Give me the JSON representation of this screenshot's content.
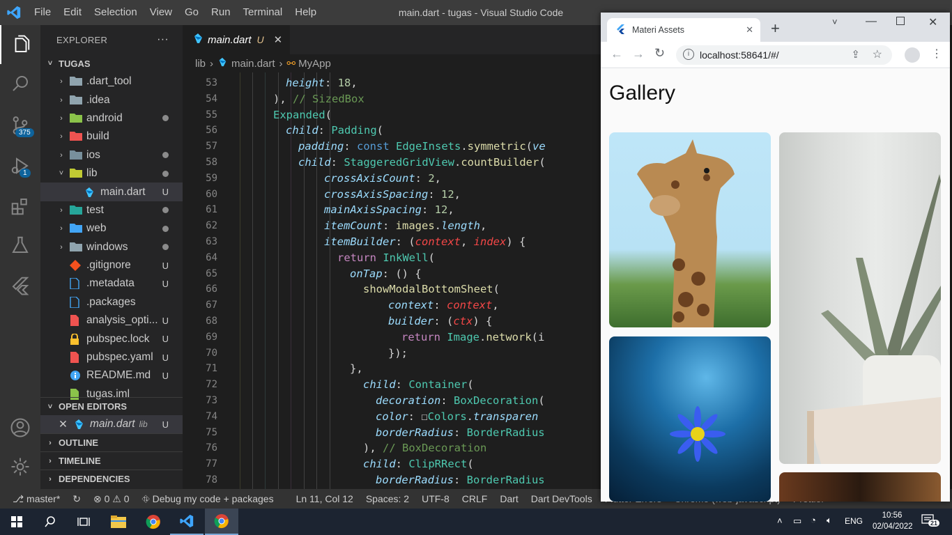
{
  "window": {
    "title": "main.dart - tugas - Visual Studio Code",
    "menu": [
      "File",
      "Edit",
      "Selection",
      "View",
      "Go",
      "Run",
      "Terminal",
      "Help"
    ]
  },
  "activity_bar": {
    "source_control_badge": "375",
    "debug_badge": "1"
  },
  "explorer": {
    "header": "EXPLORER",
    "more": "···",
    "project": "TUGAS",
    "items": [
      {
        "label": ".dart_tool",
        "chev": "›",
        "status": ""
      },
      {
        "label": ".idea",
        "chev": "›",
        "status": ""
      },
      {
        "label": "android",
        "chev": "›",
        "status": "dot"
      },
      {
        "label": "build",
        "chev": "›",
        "status": ""
      },
      {
        "label": "ios",
        "chev": "›",
        "status": "dot"
      },
      {
        "label": "lib",
        "chev": "˅",
        "status": "dot"
      },
      {
        "label": "main.dart",
        "chev": "",
        "status": "U"
      },
      {
        "label": "test",
        "chev": "›",
        "status": "dot"
      },
      {
        "label": "web",
        "chev": "›",
        "status": "dot"
      },
      {
        "label": "windows",
        "chev": "›",
        "status": "dot"
      },
      {
        "label": ".gitignore",
        "chev": "",
        "status": "U"
      },
      {
        "label": ".metadata",
        "chev": "",
        "status": "U"
      },
      {
        "label": ".packages",
        "chev": "",
        "status": ""
      },
      {
        "label": "analysis_opti...",
        "chev": "",
        "status": "U"
      },
      {
        "label": "pubspec.lock",
        "chev": "",
        "status": "U"
      },
      {
        "label": "pubspec.yaml",
        "chev": "",
        "status": "U"
      },
      {
        "label": "README.md",
        "chev": "",
        "status": "U"
      },
      {
        "label": "tugas.iml",
        "chev": "",
        "status": ""
      }
    ],
    "open_editors": "OPEN EDITORS",
    "open_editor_item": {
      "name": "main.dart",
      "dir": "lib",
      "status": "U"
    },
    "outline": "OUTLINE",
    "timeline": "TIMELINE",
    "dependencies": "DEPENDENCIES"
  },
  "editor": {
    "tab": {
      "name": "main.dart",
      "status": "U"
    },
    "breadcrumb": [
      "lib",
      "main.dart",
      "MyApp"
    ],
    "lines": [
      {
        "n": "53",
        "segs": [
          [
            "p",
            "height"
          ],
          [
            "w",
            ": "
          ],
          [
            "n",
            "18"
          ],
          [
            "w",
            ","
          ]
        ]
      },
      {
        "n": "54",
        "segs": [
          [
            "w",
            "), "
          ],
          [
            "c",
            "// SizedBox"
          ]
        ]
      },
      {
        "n": "55",
        "segs": [
          [
            "t",
            "Expanded"
          ],
          [
            "w",
            "("
          ]
        ]
      },
      {
        "n": "56",
        "segs": [
          [
            "p",
            "child"
          ],
          [
            "w",
            ": "
          ],
          [
            "t",
            "Padding"
          ],
          [
            "w",
            "("
          ]
        ]
      },
      {
        "n": "57",
        "segs": [
          [
            "p",
            "padding"
          ],
          [
            "w",
            ": "
          ],
          [
            "kb",
            "const "
          ],
          [
            "t",
            "EdgeInsets"
          ],
          [
            "w",
            "."
          ],
          [
            "f",
            "symmetric"
          ],
          [
            "w",
            "("
          ],
          [
            "p",
            "ve"
          ]
        ]
      },
      {
        "n": "58",
        "segs": [
          [
            "p",
            "child"
          ],
          [
            "w",
            ": "
          ],
          [
            "t",
            "StaggeredGridView"
          ],
          [
            "w",
            "."
          ],
          [
            "f",
            "countBuilder"
          ],
          [
            "w",
            "("
          ]
        ]
      },
      {
        "n": "59",
        "segs": [
          [
            "p",
            "crossAxisCount"
          ],
          [
            "w",
            ": "
          ],
          [
            "n",
            "2"
          ],
          [
            "w",
            ","
          ]
        ]
      },
      {
        "n": "60",
        "segs": [
          [
            "p",
            "crossAxisSpacing"
          ],
          [
            "w",
            ": "
          ],
          [
            "n",
            "12"
          ],
          [
            "w",
            ","
          ]
        ]
      },
      {
        "n": "61",
        "segs": [
          [
            "p",
            "mainAxisSpacing"
          ],
          [
            "w",
            ": "
          ],
          [
            "n",
            "12"
          ],
          [
            "w",
            ","
          ]
        ]
      },
      {
        "n": "62",
        "segs": [
          [
            "p",
            "itemCount"
          ],
          [
            "w",
            ": "
          ],
          [
            "f",
            "images"
          ],
          [
            "w",
            "."
          ],
          [
            "p",
            "length"
          ],
          [
            "w",
            ","
          ]
        ]
      },
      {
        "n": "63",
        "segs": [
          [
            "p",
            "itemBuilder"
          ],
          [
            "w",
            ": ("
          ],
          [
            "v",
            "context"
          ],
          [
            "w",
            ", "
          ],
          [
            "v",
            "index"
          ],
          [
            "w",
            ") {"
          ]
        ]
      },
      {
        "n": "64",
        "segs": [
          [
            "k",
            "return "
          ],
          [
            "t",
            "InkWell"
          ],
          [
            "w",
            "("
          ]
        ]
      },
      {
        "n": "65",
        "segs": [
          [
            "p",
            "onTap"
          ],
          [
            "w",
            ": () {"
          ]
        ]
      },
      {
        "n": "66",
        "segs": [
          [
            "f",
            "showModalBottomSheet"
          ],
          [
            "w",
            "("
          ]
        ]
      },
      {
        "n": "67",
        "segs": [
          [
            "p",
            "context"
          ],
          [
            "w",
            ": "
          ],
          [
            "v",
            "context"
          ],
          [
            "w",
            ","
          ]
        ]
      },
      {
        "n": "68",
        "segs": [
          [
            "p",
            "builder"
          ],
          [
            "w",
            ": ("
          ],
          [
            "v",
            "ctx"
          ],
          [
            "w",
            ") {"
          ]
        ]
      },
      {
        "n": "69",
        "segs": [
          [
            "k",
            "return "
          ],
          [
            "t",
            "Image"
          ],
          [
            "w",
            "."
          ],
          [
            "f",
            "network"
          ],
          [
            "w",
            "(i"
          ]
        ]
      },
      {
        "n": "70",
        "segs": [
          [
            "w",
            "});"
          ]
        ]
      },
      {
        "n": "71",
        "segs": [
          [
            "w",
            "},"
          ]
        ]
      },
      {
        "n": "72",
        "segs": [
          [
            "p",
            "child"
          ],
          [
            "w",
            ": "
          ],
          [
            "t",
            "Container"
          ],
          [
            "w",
            "("
          ]
        ]
      },
      {
        "n": "73",
        "segs": [
          [
            "p",
            "decoration"
          ],
          [
            "w",
            ": "
          ],
          [
            "t",
            "BoxDecoration"
          ],
          [
            "w",
            "("
          ]
        ]
      },
      {
        "n": "74",
        "segs": [
          [
            "p",
            "color"
          ],
          [
            "w",
            ": ☐"
          ],
          [
            "t",
            "Colors"
          ],
          [
            "w",
            "."
          ],
          [
            "p",
            "transparen"
          ]
        ]
      },
      {
        "n": "75",
        "segs": [
          [
            "p",
            "borderRadius"
          ],
          [
            "w",
            ": "
          ],
          [
            "t",
            "BorderRadius"
          ]
        ]
      },
      {
        "n": "76",
        "segs": [
          [
            "w",
            "), "
          ],
          [
            "c",
            "// BoxDecoration"
          ]
        ]
      },
      {
        "n": "77",
        "segs": [
          [
            "p",
            "child"
          ],
          [
            "w",
            ": "
          ],
          [
            "t",
            "ClipRRect"
          ],
          [
            "w",
            "("
          ]
        ]
      },
      {
        "n": "78",
        "segs": [
          [
            "p",
            "borderRadius"
          ],
          [
            "w",
            ": "
          ],
          [
            "t",
            "BorderRadius"
          ]
        ]
      }
    ]
  },
  "statusbar": {
    "branch": "master*",
    "problems": "⊗ 0 ⚠ 0",
    "debug": "Debug my code + packages",
    "position": "Ln 11, Col 12",
    "spaces": "Spaces: 2",
    "encoding": "UTF-8",
    "eol": "CRLF",
    "language": "Dart",
    "devtools": "Dart DevTools",
    "flutter_errors": "Flutter Errors",
    "chrome": "Chrome (web-javascript)",
    "prettier": "Prettier"
  },
  "browser": {
    "tab_title": "Materi Assets",
    "url": "localhost:58641/#/",
    "page_title": "Gallery"
  },
  "taskbar": {
    "time": "10:56",
    "date": "02/04/2022",
    "lang": "ENG",
    "notifications": "21"
  }
}
